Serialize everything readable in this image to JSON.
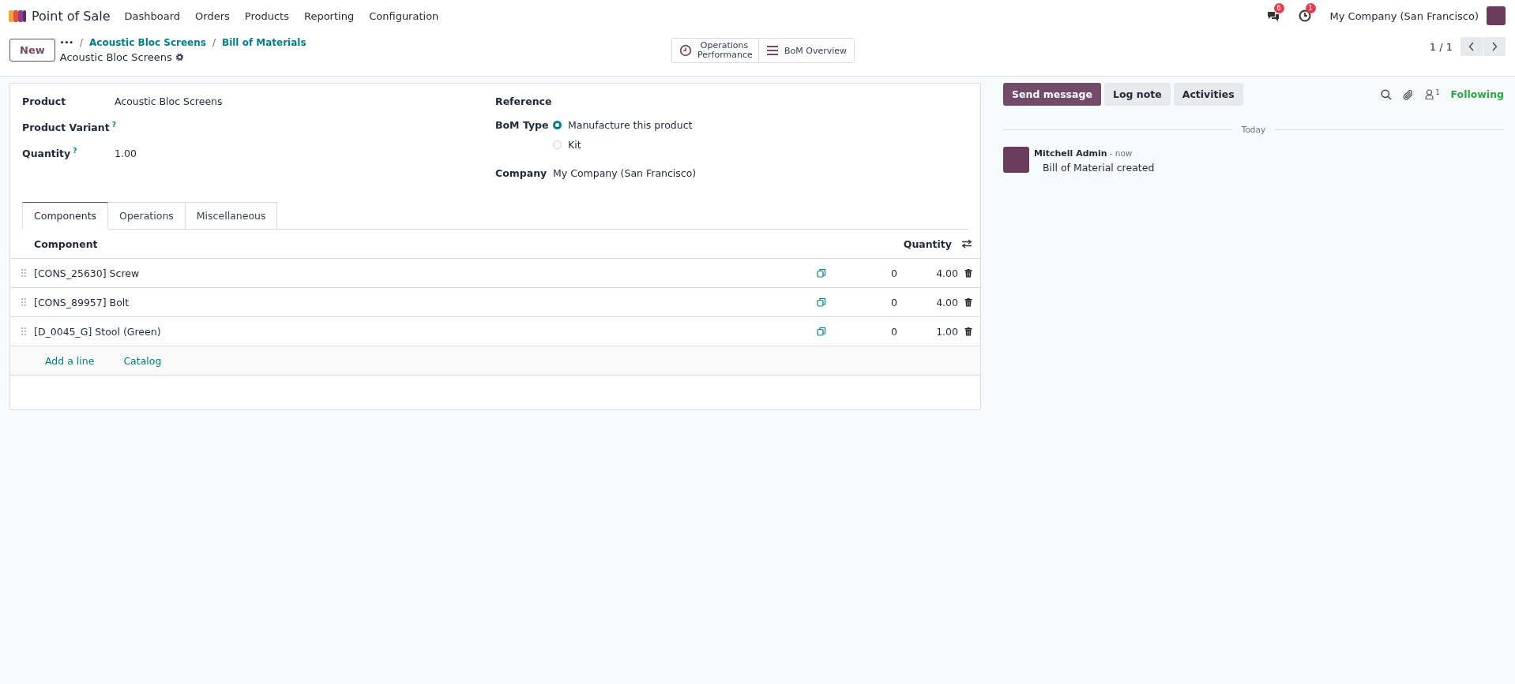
{
  "navbar": {
    "app_name": "Point of Sale",
    "menu": [
      "Dashboard",
      "Orders",
      "Products",
      "Reporting",
      "Configuration"
    ],
    "messages_count": "6",
    "activities_count": "1",
    "company": "My Company (San Francisco)"
  },
  "control_panel": {
    "new_button": "New",
    "breadcrumbs_more": "•••",
    "breadcrumbs": [
      {
        "separator": "/",
        "label": "Acoustic Bloc Screens"
      },
      {
        "separator": "/",
        "label": "Bill of Materials"
      }
    ],
    "record_title": "Acoustic Bloc Screens",
    "smart_buttons": [
      {
        "kind": "clock",
        "label": "Operations Performance"
      },
      {
        "kind": "list",
        "label": "BoM Overview"
      }
    ],
    "pager": "1 / 1"
  },
  "form": {
    "left_fields": [
      {
        "label": "Product",
        "value": "Acoustic Bloc Screens"
      },
      {
        "label": "Product Variant",
        "help": "?"
      },
      {
        "label": "Quantity",
        "help": "?",
        "value": "1.00"
      }
    ],
    "reference_label": "Reference",
    "bom_type": {
      "label": "BoM Type",
      "options": [
        {
          "label": "Manufacture this product",
          "selected": true
        },
        {
          "label": "Kit",
          "selected": false
        }
      ]
    },
    "company": {
      "label": "Company",
      "value": "My Company (San Francisco)"
    },
    "tabs": [
      {
        "label": "Components",
        "selected": true
      },
      {
        "label": "Operations",
        "selected": false
      },
      {
        "label": "Miscellaneous",
        "selected": false
      }
    ],
    "table": {
      "columns": [
        "Component",
        "Quantity"
      ],
      "rows": [
        {
          "component": "[CONS_25630] Screw",
          "column_3": "0",
          "quantity": "4.00"
        },
        {
          "component": "[CONS_89957] Bolt",
          "column_3": "0",
          "quantity": "4.00"
        },
        {
          "component": "[D_0045_G] Stool (Green)",
          "column_3": "0",
          "quantity": "1.00"
        }
      ],
      "actions": [
        "Add a line",
        "Catalog"
      ]
    }
  },
  "chatter": {
    "buttons": [
      {
        "label": "Send message",
        "selected": true
      },
      {
        "label": "Log note",
        "selected": false
      },
      {
        "label": "Activities",
        "selected": false
      }
    ],
    "followers_count": "1",
    "following": "Following",
    "date_separator": "Today",
    "messages": [
      {
        "author": "Mitchell Admin",
        "time": "- now",
        "body": "Bill of Material created"
      }
    ]
  }
}
